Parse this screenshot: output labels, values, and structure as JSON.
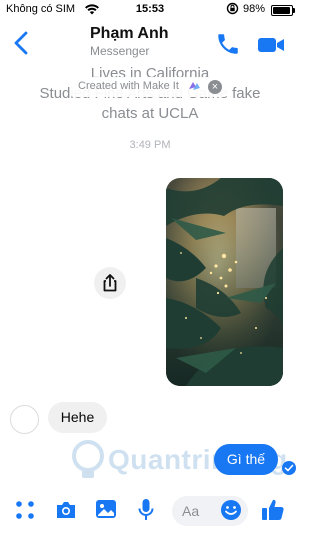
{
  "status_bar": {
    "carrier": "Không có SIM",
    "time": "15:53",
    "battery": "98%"
  },
  "header": {
    "name": "Phạm Anh",
    "subtitle": "Messenger"
  },
  "intro": {
    "line1": "Lives in California",
    "line2": "Studied Fine Arts and Game fake",
    "line3": "chats at UCLA"
  },
  "watermark": {
    "text": "Created with Make It",
    "close": "×"
  },
  "timestamp": "3:49 PM",
  "messages": [
    {
      "direction": "incoming",
      "text": "Hehe"
    },
    {
      "direction": "outgoing",
      "text": "Gì thế"
    }
  ],
  "composer": {
    "placeholder": "Aa"
  },
  "brand_watermark": "Quantrimang",
  "colors": {
    "accent": "#1877f2",
    "secondary_text": "#8a8d91",
    "incoming_bubble": "#f0f0f0"
  },
  "icons": [
    "back-chevron-icon",
    "phone-icon",
    "video-camera-icon",
    "share-icon",
    "apps-grid-icon",
    "camera-icon",
    "image-icon",
    "microphone-icon",
    "emoji-icon",
    "thumbs-up-icon",
    "check-icon",
    "close-icon"
  ]
}
